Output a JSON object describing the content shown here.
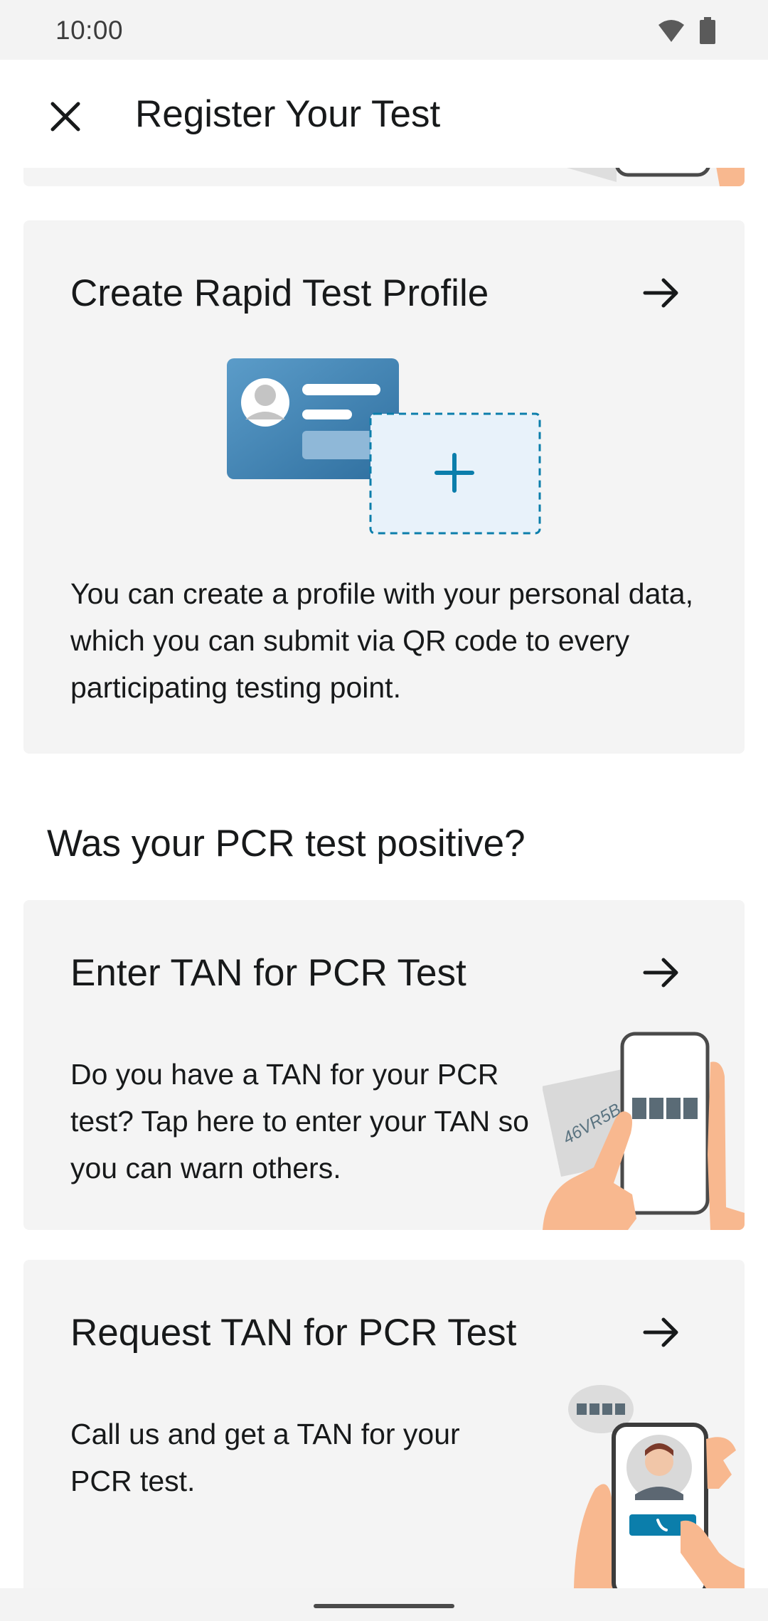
{
  "status_bar": {
    "time": "10:00",
    "icons": [
      "wifi-icon",
      "battery-icon"
    ]
  },
  "app_bar": {
    "title": "Register Your Test",
    "close_icon": "close-icon"
  },
  "cards": [
    {
      "title": "Create Rapid Test Profile",
      "body": "You can create a profile with your personal data, which you can submit via QR code to every participating testing point.",
      "icon": "arrow-right-icon",
      "illustration": "profile-card-plus-illustration"
    },
    {
      "title": "Enter TAN for PCR Test",
      "body": "Do you have a TAN for your PCR test? Tap here to enter your TAN so you can warn others.",
      "icon": "arrow-right-icon",
      "illustration": "phone-tan-entry-illustration",
      "illustration_text": "46VR5B"
    },
    {
      "title": "Request TAN for PCR Test",
      "body": "Call us and get a TAN for your PCR test.",
      "icon": "arrow-right-icon",
      "illustration": "phone-call-hotline-illustration"
    }
  ],
  "section": {
    "heading": "Was your PCR test positive?"
  },
  "colors": {
    "card_bg": "#f4f4f4",
    "text": "#17191a",
    "accent_blue": "#0b7eab",
    "skin": "#f8b88f"
  }
}
